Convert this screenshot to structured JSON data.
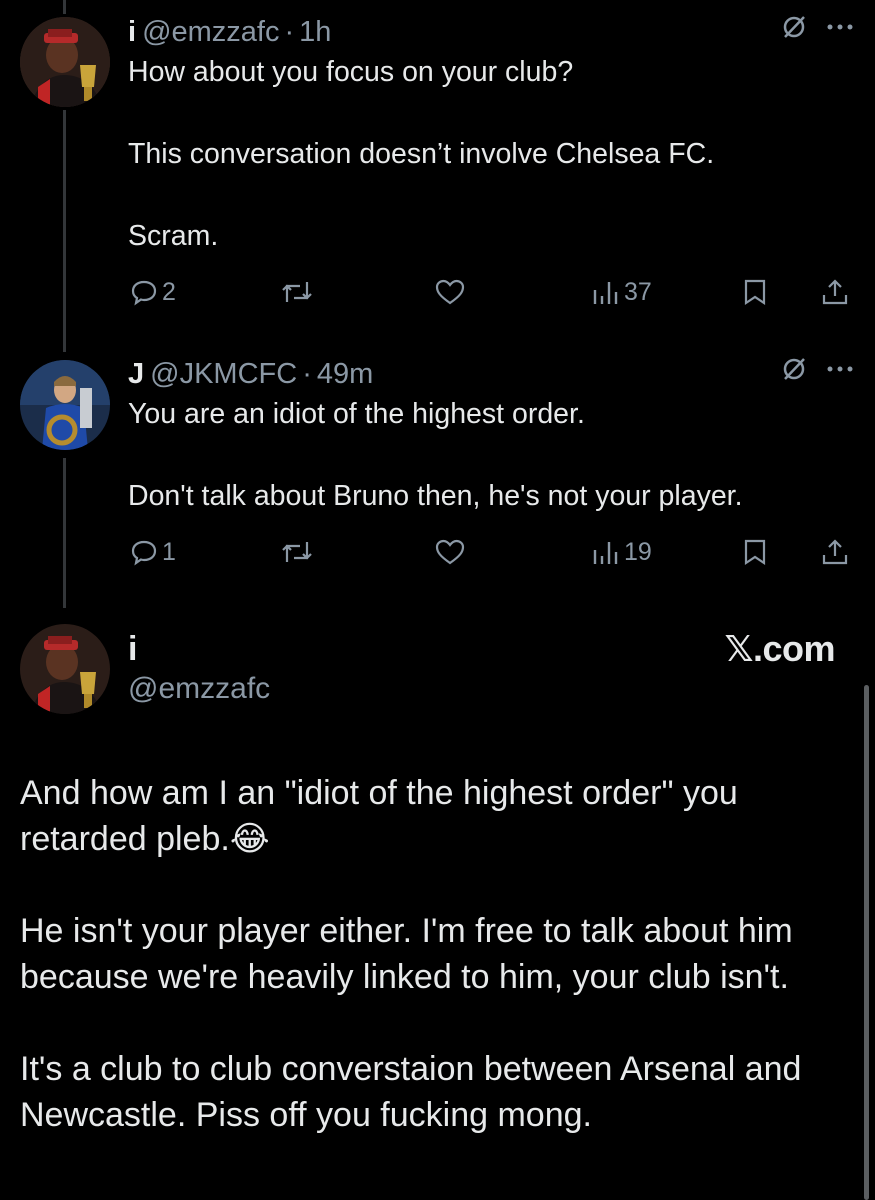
{
  "reply1": {
    "name": "i",
    "handle": "@emzzafc",
    "separator": "·",
    "time": "1h",
    "paragraphs": [
      "How about you focus on your club?",
      "This conversation doesn’t involve Chelsea FC.",
      "Scram."
    ],
    "stats": {
      "replies": "2",
      "views": "37"
    }
  },
  "reply2": {
    "name": "J",
    "handle": "@JKMCFC",
    "separator": "·",
    "time": "49m",
    "paragraphs": [
      "You are an idiot of the highest order.",
      "Don't talk about Bruno then, he's not your player."
    ],
    "stats": {
      "replies": "1",
      "views": "19"
    }
  },
  "main": {
    "name": "i",
    "handle": "@emzzafc",
    "watermark": "𝕏.com",
    "paragraph1_text": "And how am I an \"idiot of the highest order\" you retarded pleb.",
    "paragraph1_emoji": "😂",
    "paragraph2": "He isn't your player either. I'm free to talk about him because we're heavily linked to him, your club isn't.",
    "paragraph3": "It's a club to club converstaion between Arsenal and Newcastle.  Piss off you fucking mong."
  },
  "icons": {
    "reply": "comment-icon",
    "retweet": "retweet-icon",
    "like": "heart-icon",
    "views": "views-bar-icon",
    "bookmark": "bookmark-icon",
    "share": "share-icon",
    "grok": "grok-icon",
    "more": "more-icon"
  },
  "colors": {
    "background": "#000000",
    "text": "#e7e9ea",
    "secondary": "#8b98a5",
    "thread_line": "#333639"
  }
}
